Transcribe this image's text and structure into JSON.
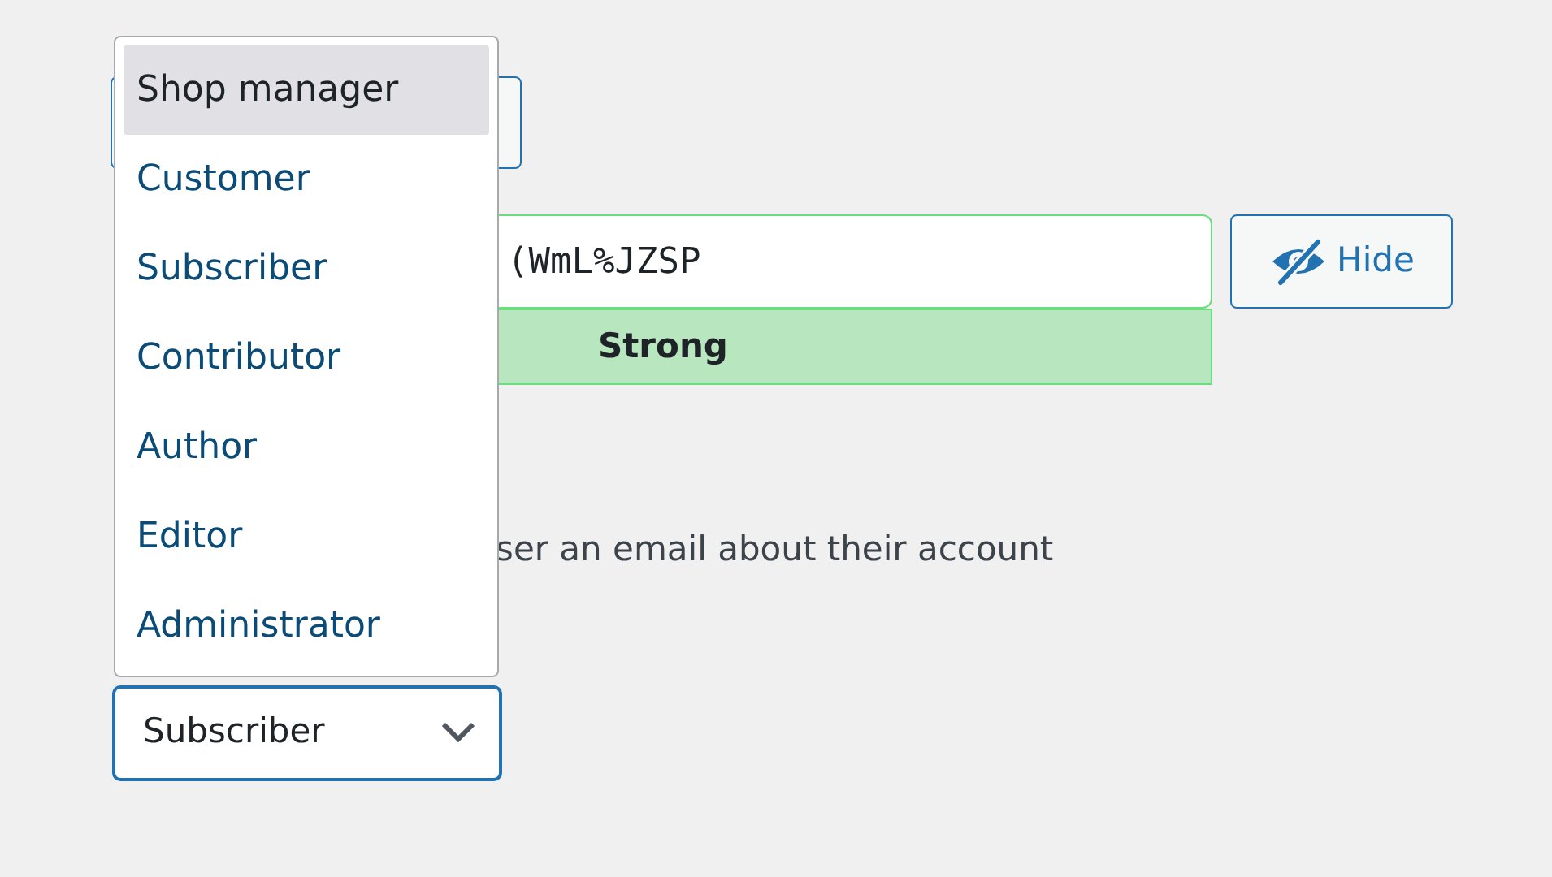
{
  "password": {
    "value": "(WmL%JZSP",
    "strength": "Strong",
    "toggle_label": "Hide"
  },
  "notify": {
    "label": "ser an email about their account"
  },
  "role_select": {
    "value": "Subscriber",
    "expanded": true,
    "options": [
      {
        "label": "Shop manager",
        "highlighted": true
      },
      {
        "label": "Customer",
        "highlighted": false
      },
      {
        "label": "Subscriber",
        "highlighted": false
      },
      {
        "label": "Contributor",
        "highlighted": false
      },
      {
        "label": "Author",
        "highlighted": false
      },
      {
        "label": "Editor",
        "highlighted": false
      },
      {
        "label": "Administrator",
        "highlighted": false
      }
    ]
  }
}
